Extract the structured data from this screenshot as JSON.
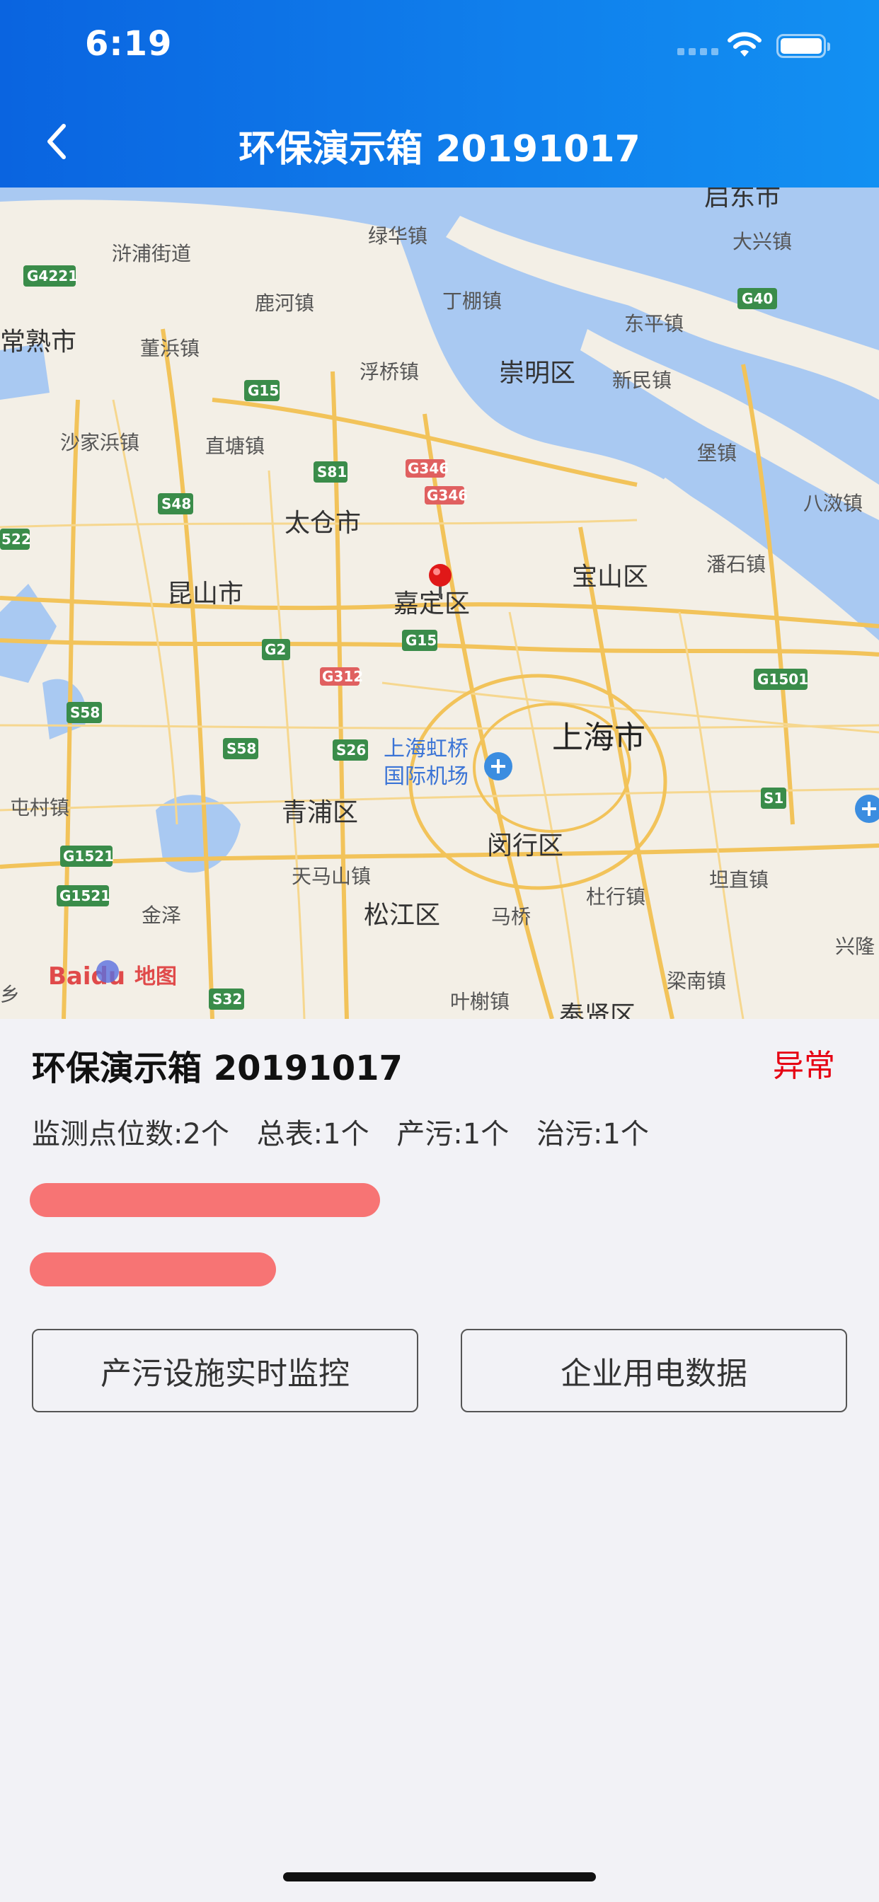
{
  "status_bar": {
    "time": "6:19"
  },
  "nav": {
    "title": "环保演示箱 20191017"
  },
  "map": {
    "labels": {
      "qidong": "启东市",
      "xupu": "浒浦街道",
      "lvhua": "绿华镇",
      "daxing": "大兴镇",
      "g4221": "G4221",
      "luhe": "鹿河镇",
      "dingpeng": "丁棚镇",
      "g40": "G40",
      "changshu": "常熟市",
      "dongbin": "董浜镇",
      "dongping": "东平镇",
      "g15a": "G15",
      "fuqiao": "浮桥镇",
      "chongming": "崇明区",
      "xinmin": "新民镇",
      "shajiabang": "沙家浜镇",
      "zhitang": "直塘镇",
      "bao": "堡镇",
      "s81": "S81",
      "g346a": "G346",
      "g346b": "G346",
      "s48": "S48",
      "bajiao": "八滧镇",
      "taicang": "太仓市",
      "n522": "522",
      "kunshan": "昆山市",
      "jiading": "嘉定区",
      "baoshan": "宝山区",
      "panshi": "潘石镇",
      "g15b": "G15",
      "g2": "G2",
      "g312": "G312",
      "g1501": "G1501",
      "s58a": "S58",
      "s58b": "S58",
      "s26": "S26",
      "hongqiao": "上海虹桥",
      "airport": "国际机场",
      "shanghai": "上海市",
      "dianshan": "屯村镇",
      "qingpu": "青浦区",
      "s1": "S1",
      "minhang": "闵行区",
      "g1521a": "G1521",
      "tianmashan": "天马山镇",
      "zhuanqiao": "坦直镇",
      "g1521b": "G1521",
      "jinze": "金泽",
      "songjiang": "松江区",
      "maqiao": "马桥",
      "duhang": "杜行镇",
      "xingqiao": "兴隆",
      "liangnan": "梁南镇",
      "s32": "S32",
      "yexie": "叶榭镇",
      "fengxian": "奉贤区",
      "xiang": "乡",
      "baidu_logo": "Baidu",
      "baidu_map": "地图"
    }
  },
  "info": {
    "name": "环保演示箱 20191017",
    "status": "异常",
    "status_color": "#e60012",
    "stats": [
      "监测点位数:2个",
      "总表:1个",
      "产污:1个",
      "治污:1个"
    ]
  },
  "buttons": {
    "left": "产污设施实时监控",
    "right": "企业用电数据"
  }
}
